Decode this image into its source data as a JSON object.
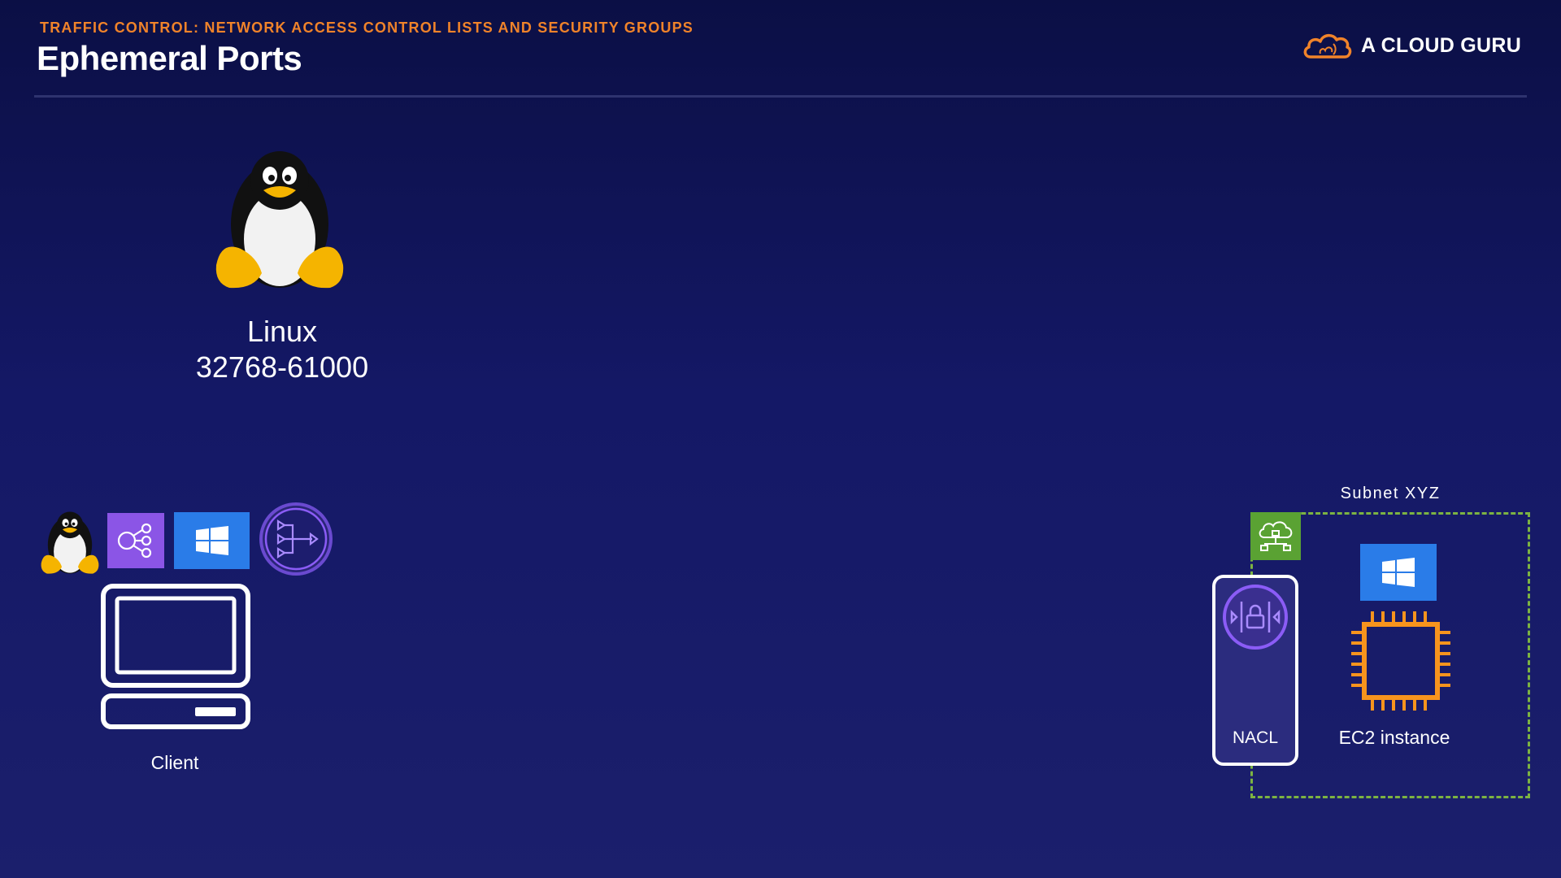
{
  "header": {
    "kicker": "TRAFFIC CONTROL: NETWORK ACCESS CONTROL LISTS AND SECURITY GROUPS",
    "title": "Ephemeral Ports",
    "brand": "A CLOUD GURU",
    "brand_icon": "cloud-icon"
  },
  "featured_os": {
    "icon": "tux-penguin-icon",
    "name": "Linux",
    "port_range": "32768-61000"
  },
  "client": {
    "os_icons": [
      "tux-penguin-icon",
      "share-nodes-icon",
      "windows-icon",
      "routing-icon"
    ],
    "device_icon": "laptop-icon",
    "label": "Client"
  },
  "subnet": {
    "label": "Subnet XYZ",
    "gateway_icon": "internet-gateway-icon",
    "nacl": {
      "icon": "nacl-lock-icon",
      "label": "NACL"
    },
    "instance": {
      "os_icon": "windows-icon",
      "icon": "ec2-chip-icon",
      "label": "EC2 instance"
    }
  },
  "colors": {
    "background_top": "#0b0f45",
    "background_bottom": "#1b1f6c",
    "accent_orange": "#f0832a",
    "windows_blue": "#2a7ce8",
    "purple": "#8b55e6",
    "subnet_green": "#7cb342",
    "ec2_orange": "#f7941d"
  }
}
